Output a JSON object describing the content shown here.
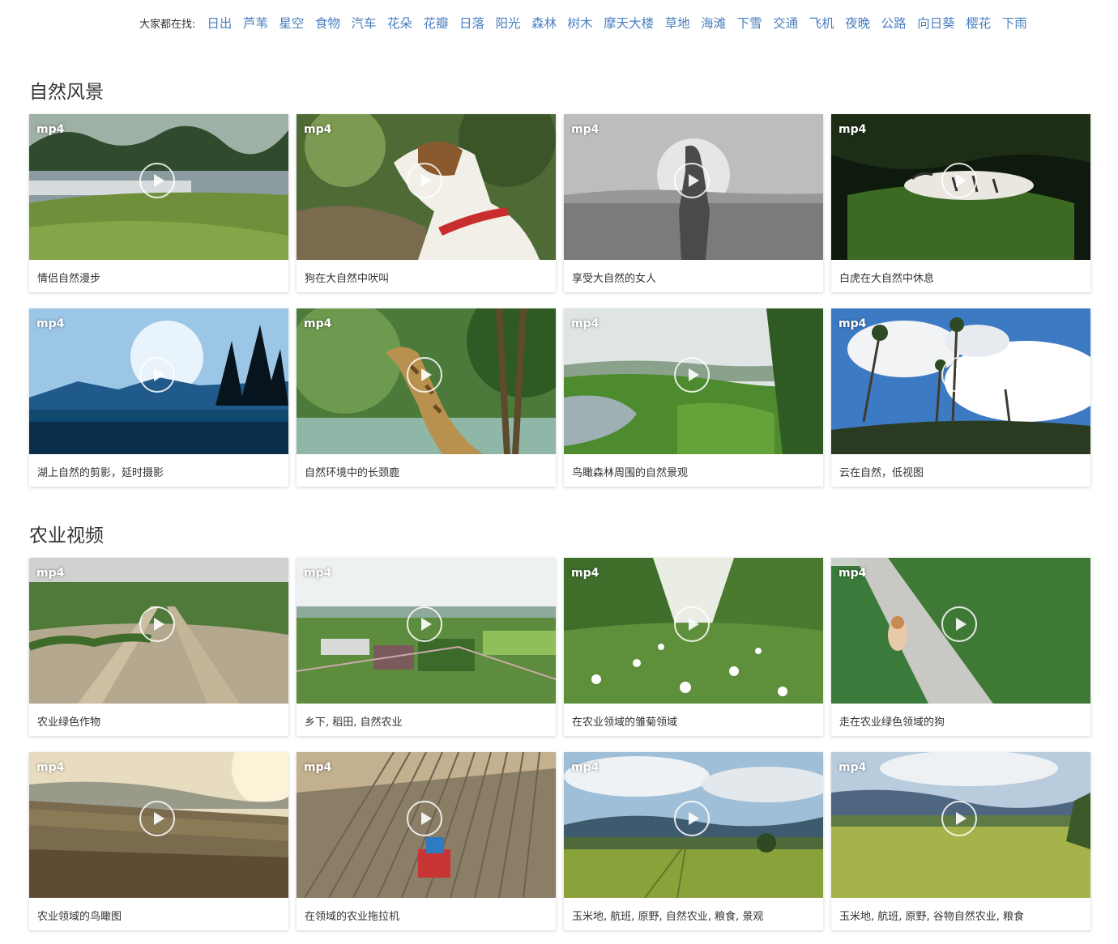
{
  "search_tags": {
    "lead": "大家都在找:",
    "items": [
      "日出",
      "芦苇",
      "星空",
      "食物",
      "汽车",
      "花朵",
      "花瓣",
      "日落",
      "阳光",
      "森林",
      "树木",
      "摩天大楼",
      "草地",
      "海滩",
      "下雪",
      "交通",
      "飞机",
      "夜晚",
      "公路",
      "向日葵",
      "樱花",
      "下雨"
    ]
  },
  "sections": [
    {
      "title": "自然风景",
      "videos": [
        {
          "format": "mp4",
          "caption": "情侣自然漫步",
          "scene": "lake-meadow"
        },
        {
          "format": "mp4",
          "caption": "狗在大自然中吠叫",
          "scene": "dog-forest"
        },
        {
          "format": "mp4",
          "caption": "享受大自然的女人",
          "scene": "woman-field-bw"
        },
        {
          "format": "mp4",
          "caption": "白虎在大自然中休息",
          "scene": "tiger-grass"
        },
        {
          "format": "mp4",
          "caption": "湖上自然的剪影，延时摄影",
          "scene": "blue-lake-silhouette"
        },
        {
          "format": "mp4",
          "caption": "自然环境中的长颈鹿",
          "scene": "giraffe-forest"
        },
        {
          "format": "mp4",
          "caption": "鸟瞰森林周围的自然景观",
          "scene": "forest-lake-aerial"
        },
        {
          "format": "mp4",
          "caption": "云在自然，低视图",
          "scene": "palms-clouds"
        }
      ]
    },
    {
      "title": "农业视频",
      "videos": [
        {
          "format": "mp4",
          "caption": "农业绿色作物",
          "scene": "crop-rows"
        },
        {
          "format": "mp4",
          "caption": "乡下, 稻田, 自然农业",
          "scene": "rice-fields-aerial"
        },
        {
          "format": "mp4",
          "caption": "在农业领域的雏菊领域",
          "scene": "daisy-orchard"
        },
        {
          "format": "mp4",
          "caption": "走在农业绿色领域的狗",
          "scene": "dog-road-field"
        },
        {
          "format": "mp4",
          "caption": "农业领域的鸟瞰图",
          "scene": "sunset-field-aerial"
        },
        {
          "format": "mp4",
          "caption": "在领域的农业拖拉机",
          "scene": "tractor-field"
        },
        {
          "format": "mp4",
          "caption": "玉米地, 航班, 原野, 自然农业, 粮食, 景观",
          "scene": "green-field-hills"
        },
        {
          "format": "mp4",
          "caption": "玉米地, 航班, 原野, 谷物自然农业, 粮食",
          "scene": "wheat-field-hills"
        }
      ]
    }
  ],
  "colors": {
    "tag_link": "#4a7fc0",
    "text": "#333333"
  },
  "icons": {
    "play": "play-circle-icon"
  }
}
